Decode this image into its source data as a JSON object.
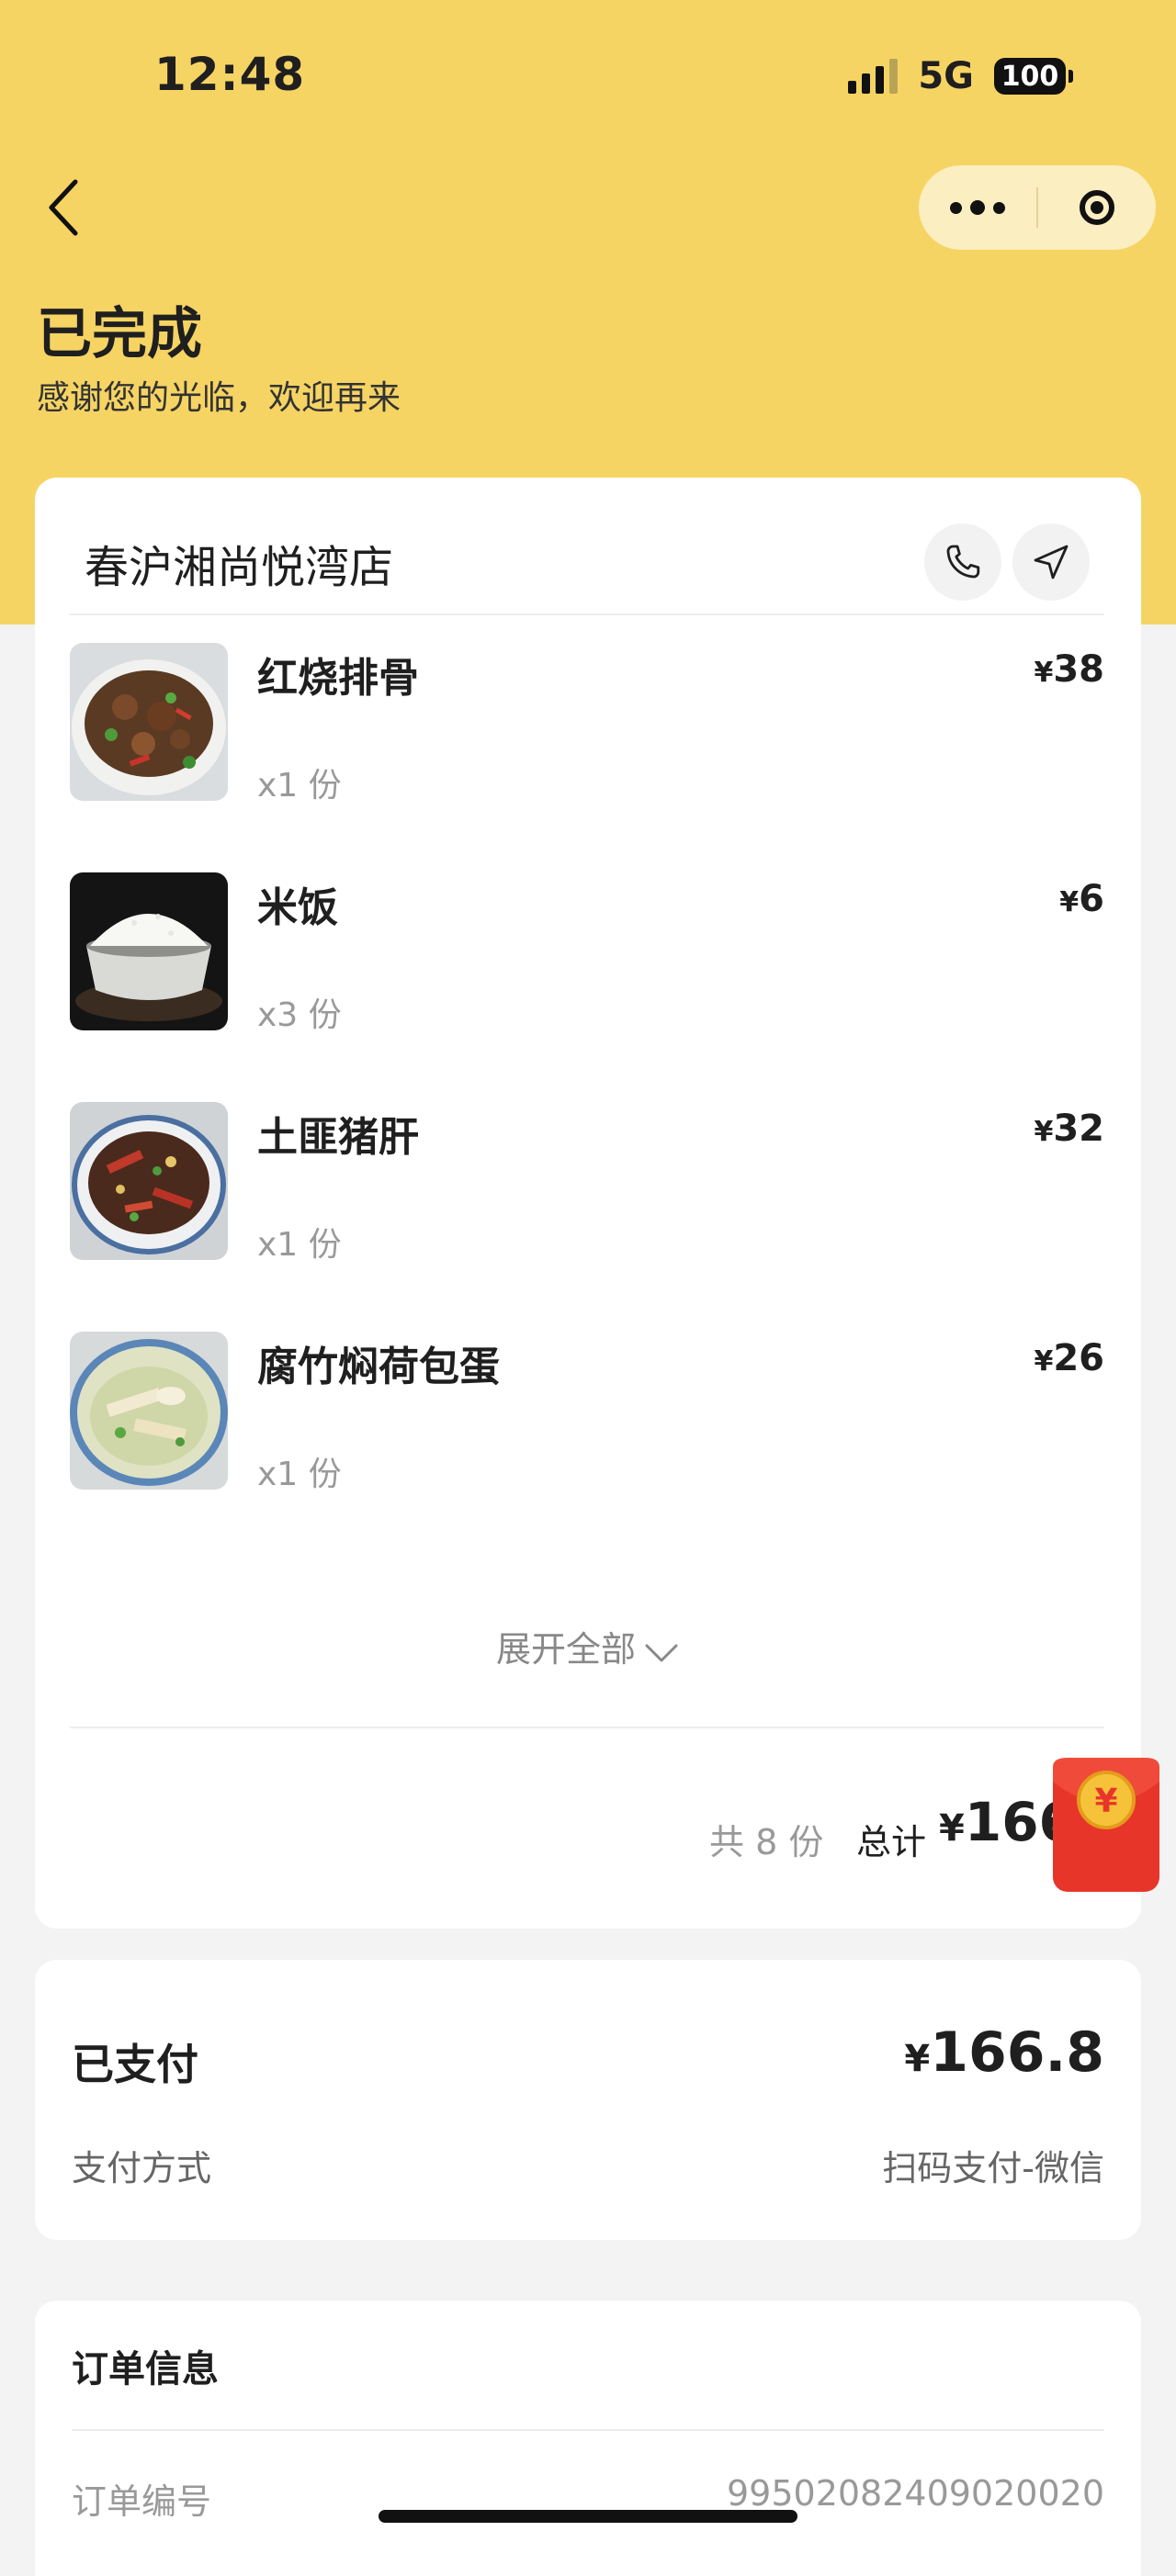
{
  "status_bar": {
    "time": "12:48",
    "network": "5G",
    "battery": "100"
  },
  "header": {
    "status_title": "已完成",
    "status_subtitle": "感谢您的光临，欢迎再来"
  },
  "shop": {
    "name": "春沪湘尚悦湾店"
  },
  "dishes": [
    {
      "name": "红烧排骨",
      "qty": "x1 份",
      "price": "38",
      "image": "braised-pork-ribs"
    },
    {
      "name": "米饭",
      "qty": "x3 份",
      "price": "6",
      "image": "rice-bowl"
    },
    {
      "name": "土匪猪肝",
      "qty": "x1 份",
      "price": "32",
      "image": "stir-fried-pork-liver"
    },
    {
      "name": "腐竹焖荷包蛋",
      "qty": "x1 份",
      "price": "26",
      "image": "tofu-skin-egg"
    }
  ],
  "expand_label": "展开全部",
  "summary": {
    "count": "共 8 份",
    "total_label": "总计",
    "currency": "¥",
    "total_value": "166"
  },
  "payment": {
    "paid_label": "已支付",
    "currency": "¥",
    "paid_value": "166.8",
    "method_label": "支付方式",
    "method_value": "扫码支付-微信"
  },
  "order": {
    "title": "订单信息",
    "number_label": "订单编号",
    "number_value": "99502082409020020"
  },
  "colors": {
    "header_bg": "#f6d463",
    "capsule_bg": "#fbeec0",
    "page_bg": "#f3f3f3",
    "red_packet": "#e8352a"
  }
}
